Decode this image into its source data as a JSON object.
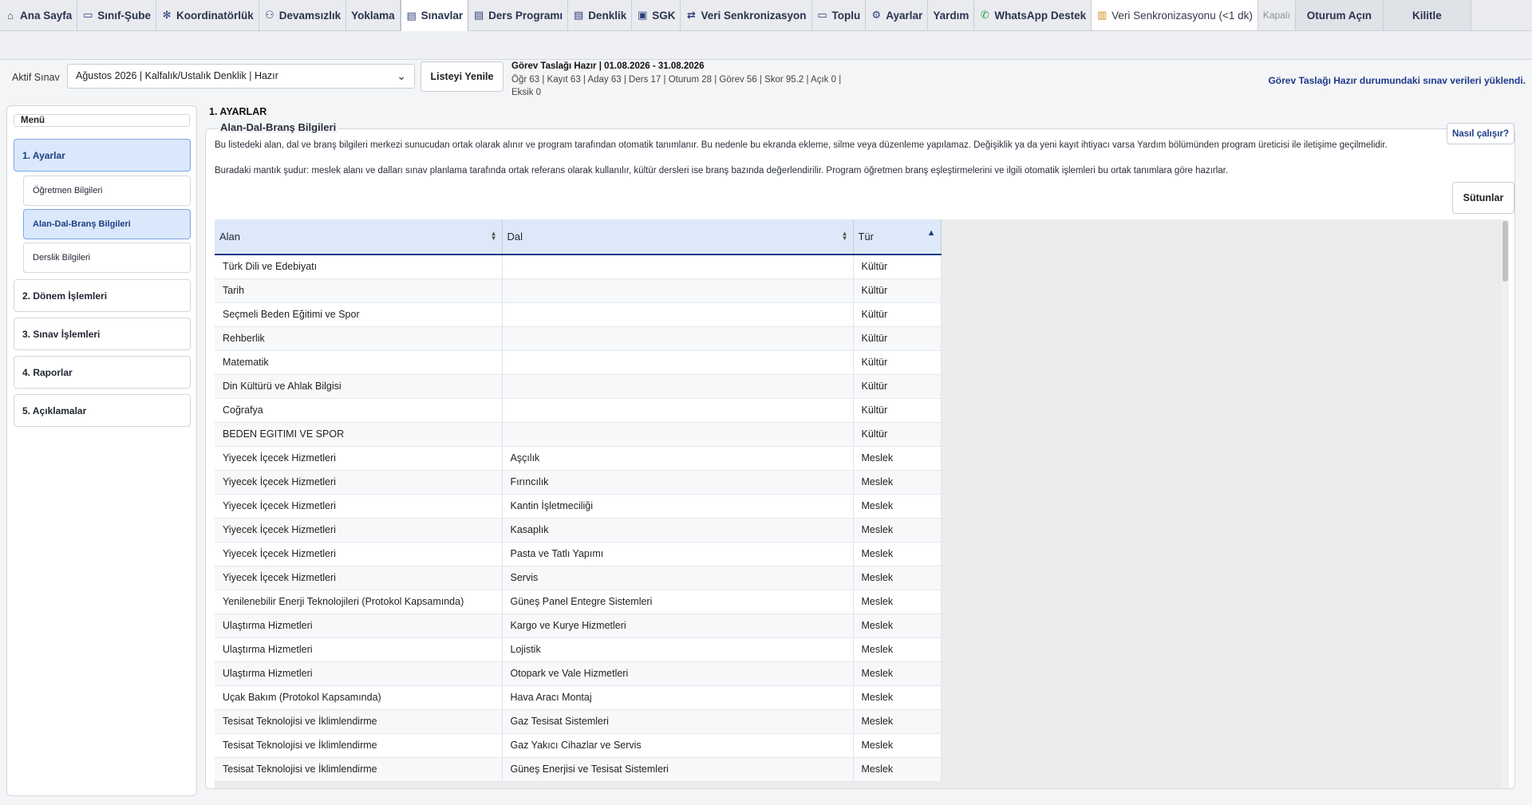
{
  "tabs": [
    {
      "icon": "home-icon",
      "glyph": "⌂",
      "label": "Ana Sayfa"
    },
    {
      "icon": "class-icon",
      "glyph": "▭",
      "label": "Sınıf-Şube"
    },
    {
      "icon": "coordinator-icon",
      "glyph": "✻",
      "label": "Koordinatörlük"
    },
    {
      "icon": "absence-icon",
      "glyph": "⚇",
      "label": "Devamsızlık"
    },
    {
      "icon": "",
      "glyph": "",
      "label": "Yoklama"
    },
    {
      "icon": "exams-icon",
      "glyph": "▤",
      "label": "Sınavlar",
      "active": true
    },
    {
      "icon": "schedule-icon",
      "glyph": "▤",
      "label": "Ders Programı"
    },
    {
      "icon": "equivalence-icon",
      "glyph": "▤",
      "label": "Denklik"
    },
    {
      "icon": "sgk-icon",
      "glyph": "▣",
      "label": "SGK"
    },
    {
      "icon": "sync-icon",
      "glyph": "⇄",
      "label": "Veri Senkronizasyon"
    },
    {
      "icon": "bulk-icon",
      "glyph": "▭",
      "label": "Toplu"
    },
    {
      "icon": "settings-icon",
      "glyph": "⚙",
      "label": "Ayarlar"
    },
    {
      "icon": "",
      "glyph": "",
      "label": "Yardım"
    },
    {
      "icon": "whatsapp-icon",
      "glyph": "✆",
      "label": "WhatsApp Destek"
    },
    {
      "icon": "database-icon",
      "glyph": "▥",
      "label": "Veri Senkronizasyonu (<1 dk)",
      "plain": true
    },
    {
      "icon": "",
      "glyph": "",
      "label": "Kapalı",
      "muted": true
    },
    {
      "icon": "",
      "glyph": "",
      "label": "Oturum Açın",
      "wide": true
    },
    {
      "icon": "",
      "glyph": "",
      "label": "Kilitle",
      "wide": true
    }
  ],
  "exam": {
    "label": "Aktif Sınav",
    "selected": "Ağustos 2026 | Kalfalık/Ustalık Denklik | Hazır",
    "refresh_label": "Listeyi Yenile"
  },
  "status": {
    "title": "Görev Taslağı Hazır | 01.08.2026 - 31.08.2026",
    "line1": "Öğr 63 | Kayıt 63 | Aday 63 | Ders 17 | Oturum 28 | Görev 56 | Skor 95.2 | Açık 0 |",
    "line2": "Eksik 0",
    "message": "Görev Taslağı Hazır durumundaki sınav verileri yüklendi."
  },
  "sidebar": {
    "legend": "Menü",
    "items": [
      {
        "label": "1. Ayarlar",
        "active": true
      },
      {
        "label": "2. Dönem İşlemleri"
      },
      {
        "label": "3. Sınav İşlemleri"
      },
      {
        "label": "4. Raporlar"
      },
      {
        "label": "5. Açıklamalar"
      }
    ],
    "subitems": [
      {
        "label": "Öğretmen Bilgileri"
      },
      {
        "label": "Alan-Dal-Branş Bilgileri",
        "active": true
      },
      {
        "label": "Derslik Bilgileri"
      }
    ]
  },
  "main": {
    "title": "1. AYARLAR",
    "panel_title": "Alan-Dal-Branş Bilgileri",
    "help_label": "Nasıl çalışır?",
    "desc1": "Bu listedeki alan, dal ve branş bilgileri merkezi sunucudan ortak olarak alınır ve program tarafından otomatik tanımlanır. Bu nedenle bu ekranda ekleme, silme veya düzenleme yapılamaz. Değişiklik ya da yeni kayıt ihtiyacı varsa Yardım bölümünden program üreticisi ile iletişime geçilmelidir.",
    "desc2": "Buradaki mantık şudur: meslek alanı ve dalları sınav planlama tarafında ortak referans olarak kullanılır, kültür dersleri ise branş bazında değerlendirilir. Program öğretmen branş eşleştirmelerini ve ilgili otomatik işlemleri bu ortak tanımlara göre hazırlar.",
    "columns_label": "Sütunlar"
  },
  "table": {
    "headers": {
      "alan": "Alan",
      "dal": "Dal",
      "tur": "Tür"
    },
    "rows": [
      {
        "alan": "Türk Dili ve Edebiyatı",
        "dal": "",
        "tur": "Kültür"
      },
      {
        "alan": "Tarih",
        "dal": "",
        "tur": "Kültür"
      },
      {
        "alan": "Seçmeli Beden Eğitimi ve Spor",
        "dal": "",
        "tur": "Kültür"
      },
      {
        "alan": "Rehberlik",
        "dal": "",
        "tur": "Kültür"
      },
      {
        "alan": "Matematik",
        "dal": "",
        "tur": "Kültür"
      },
      {
        "alan": "Din Kültürü ve Ahlak Bilgisi",
        "dal": "",
        "tur": "Kültür"
      },
      {
        "alan": "Coğrafya",
        "dal": "",
        "tur": "Kültür"
      },
      {
        "alan": "BEDEN EGITIMI VE SPOR",
        "dal": "",
        "tur": "Kültür"
      },
      {
        "alan": "Yiyecek İçecek Hizmetleri",
        "dal": "Aşçılık",
        "tur": "Meslek"
      },
      {
        "alan": "Yiyecek İçecek Hizmetleri",
        "dal": "Fırıncılık",
        "tur": "Meslek"
      },
      {
        "alan": "Yiyecek İçecek Hizmetleri",
        "dal": "Kantin İşletmeciliği",
        "tur": "Meslek"
      },
      {
        "alan": "Yiyecek İçecek Hizmetleri",
        "dal": "Kasaplık",
        "tur": "Meslek"
      },
      {
        "alan": "Yiyecek İçecek Hizmetleri",
        "dal": "Pasta ve Tatlı Yapımı",
        "tur": "Meslek"
      },
      {
        "alan": "Yiyecek İçecek Hizmetleri",
        "dal": "Servis",
        "tur": "Meslek"
      },
      {
        "alan": "Yenilenebilir Enerji Teknolojileri (Protokol Kapsamında)",
        "dal": "Güneş Panel Entegre Sistemleri",
        "tur": "Meslek"
      },
      {
        "alan": "Ulaştırma Hizmetleri",
        "dal": "Kargo ve Kurye Hizmetleri",
        "tur": "Meslek"
      },
      {
        "alan": "Ulaştırma Hizmetleri",
        "dal": "Lojistik",
        "tur": "Meslek"
      },
      {
        "alan": "Ulaştırma Hizmetleri",
        "dal": "Otopark ve Vale Hizmetleri",
        "tur": "Meslek"
      },
      {
        "alan": "Uçak Bakım (Protokol Kapsamında)",
        "dal": "Hava Aracı Montaj",
        "tur": "Meslek"
      },
      {
        "alan": "Tesisat Teknolojisi ve İklimlendirme",
        "dal": "Gaz Tesisat Sistemleri",
        "tur": "Meslek"
      },
      {
        "alan": "Tesisat Teknolojisi ve İklimlendirme",
        "dal": "Gaz Yakıcı Cihazlar ve Servis",
        "tur": "Meslek"
      },
      {
        "alan": "Tesisat Teknolojisi ve İklimlendirme",
        "dal": "Güneş Enerjisi ve Tesisat Sistemleri",
        "tur": "Meslek"
      }
    ]
  }
}
